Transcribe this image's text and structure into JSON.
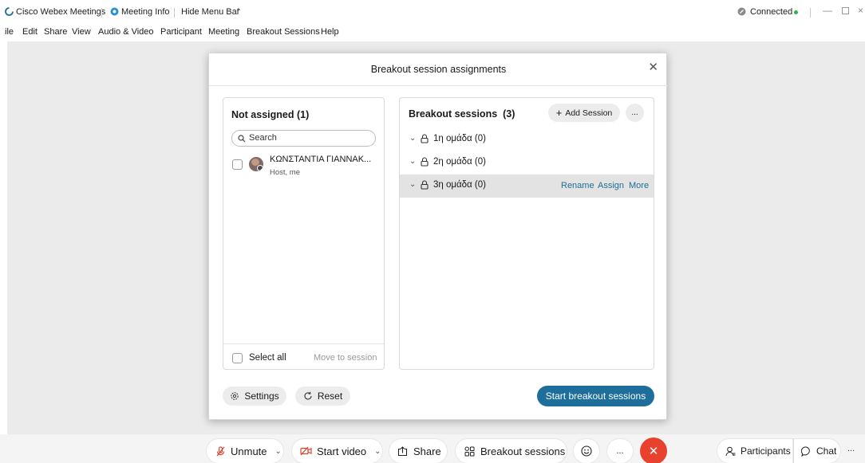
{
  "titlebar": {
    "app_name": "Cisco Webex Meetings",
    "meeting_info": "Meeting Info",
    "hide_menu_bar": "Hide Menu Bar",
    "connected": "Connected"
  },
  "menu": [
    "ile",
    "Edit",
    "Share",
    "View",
    "Audio & Video",
    "Participant",
    "Meeting",
    "Breakout Sessions",
    "Help"
  ],
  "dialog": {
    "title": "Breakout session assignments",
    "not_assigned": {
      "heading": "Not assigned (1)",
      "search_placeholder": "Search",
      "participant": {
        "name": "ΚΩΝΣΤΑΝΤΙΑ ΓΙΑΝΝΑΚ...",
        "role": "Host, me"
      },
      "select_all": "Select all",
      "move_to_session": "Move to session"
    },
    "breakout": {
      "heading": "Breakout sessions  (3)",
      "add_session": "Add Session",
      "more_icon": "...",
      "sessions": [
        {
          "label": "1η ομάδα (0)"
        },
        {
          "label": "2η ομάδα (0)"
        },
        {
          "label": "3η ομάδα (0)"
        }
      ],
      "actions": {
        "rename": "Rename",
        "assign": "Assign",
        "more": "More"
      }
    },
    "settings": "Settings",
    "reset": "Reset",
    "start": "Start breakout sessions"
  },
  "controls": {
    "unmute": "Unmute",
    "start_video": "Start video",
    "share": "Share",
    "breakout_sessions": "Breakout sessions",
    "more": "...",
    "participants": "Participants",
    "chat": "Chat",
    "overflow": "..."
  },
  "colors": {
    "primary": "#1e6e9c",
    "end_call": "#e8412e",
    "link": "#1f6e96",
    "connected_dot": "#2fb24b"
  }
}
